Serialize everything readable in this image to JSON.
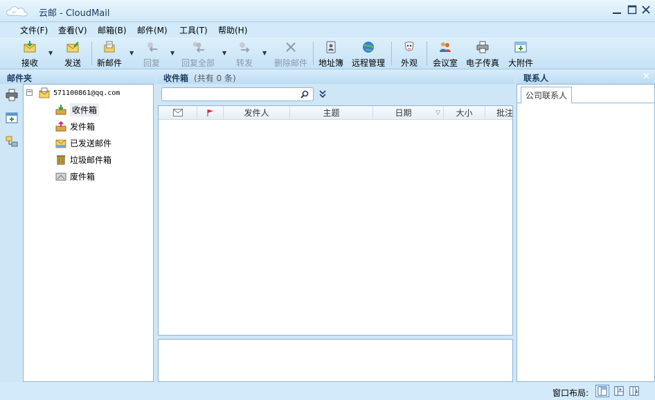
{
  "app": {
    "title": "云邮 - CloudMail"
  },
  "menu": [
    "文件(F)",
    "查看(V)",
    "邮箱(B)",
    "邮件(M)",
    "工具(T)",
    "帮助(H)"
  ],
  "toolbar": {
    "receive": "接收",
    "send": "发送",
    "new_mail": "新邮件",
    "reply": "回复",
    "reply_all": "回复全部",
    "forward": "转发",
    "delete": "删除邮件",
    "address_book": "地址簿",
    "remote_manage": "远程管理",
    "appearance": "外观",
    "meeting_room": "会议室",
    "fax": "电子传真",
    "large_attachment": "大附件"
  },
  "folder_pane": {
    "title": "邮件夹",
    "account": "571100861@qq.com",
    "folders": [
      "收件箱",
      "发件箱",
      "已发送邮件",
      "垃圾邮件箱",
      "废件箱"
    ]
  },
  "message_pane": {
    "title": "收件箱",
    "count": "(共有 0 条)",
    "search": {
      "value": "",
      "placeholder": ""
    },
    "columns": [
      "发件人",
      "主题",
      "日期",
      "大小",
      "批注"
    ]
  },
  "contact_pane": {
    "title": "联系人",
    "tab": "公司联系人"
  },
  "status": {
    "layout_label": "窗口布局:"
  },
  "colors": {
    "accent": "#1c3c63",
    "pane_bg": "#cfe6f7",
    "border": "#8fb4d2"
  }
}
